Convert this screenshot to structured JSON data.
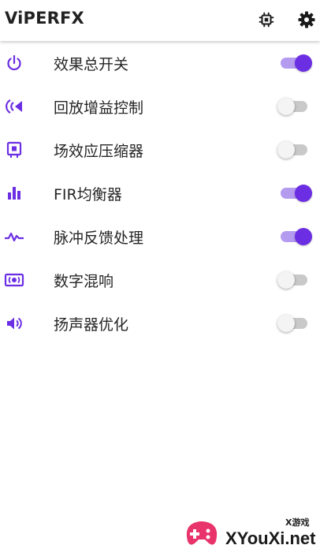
{
  "app": {
    "title": "ViPERFX",
    "accent_color": "#6b2ee3",
    "actions": [
      {
        "icon": "chip-icon"
      },
      {
        "icon": "gear-icon"
      }
    ]
  },
  "settings": [
    {
      "label": "效果总开关",
      "icon": "power-icon",
      "enabled": true
    },
    {
      "label": "回放增益控制",
      "icon": "playback-gain-icon",
      "enabled": false
    },
    {
      "label": "场效应压缩器",
      "icon": "compressor-icon",
      "enabled": false
    },
    {
      "label": "FIR均衡器",
      "icon": "equalizer-icon",
      "enabled": true
    },
    {
      "label": "脉冲反馈处理",
      "icon": "pulse-icon",
      "enabled": true
    },
    {
      "label": "数字混响",
      "icon": "reverb-icon",
      "enabled": false
    },
    {
      "label": "扬声器优化",
      "icon": "speaker-icon",
      "enabled": false
    }
  ],
  "watermark": {
    "small_text": "X游戏",
    "text": "XYouXi.net"
  }
}
